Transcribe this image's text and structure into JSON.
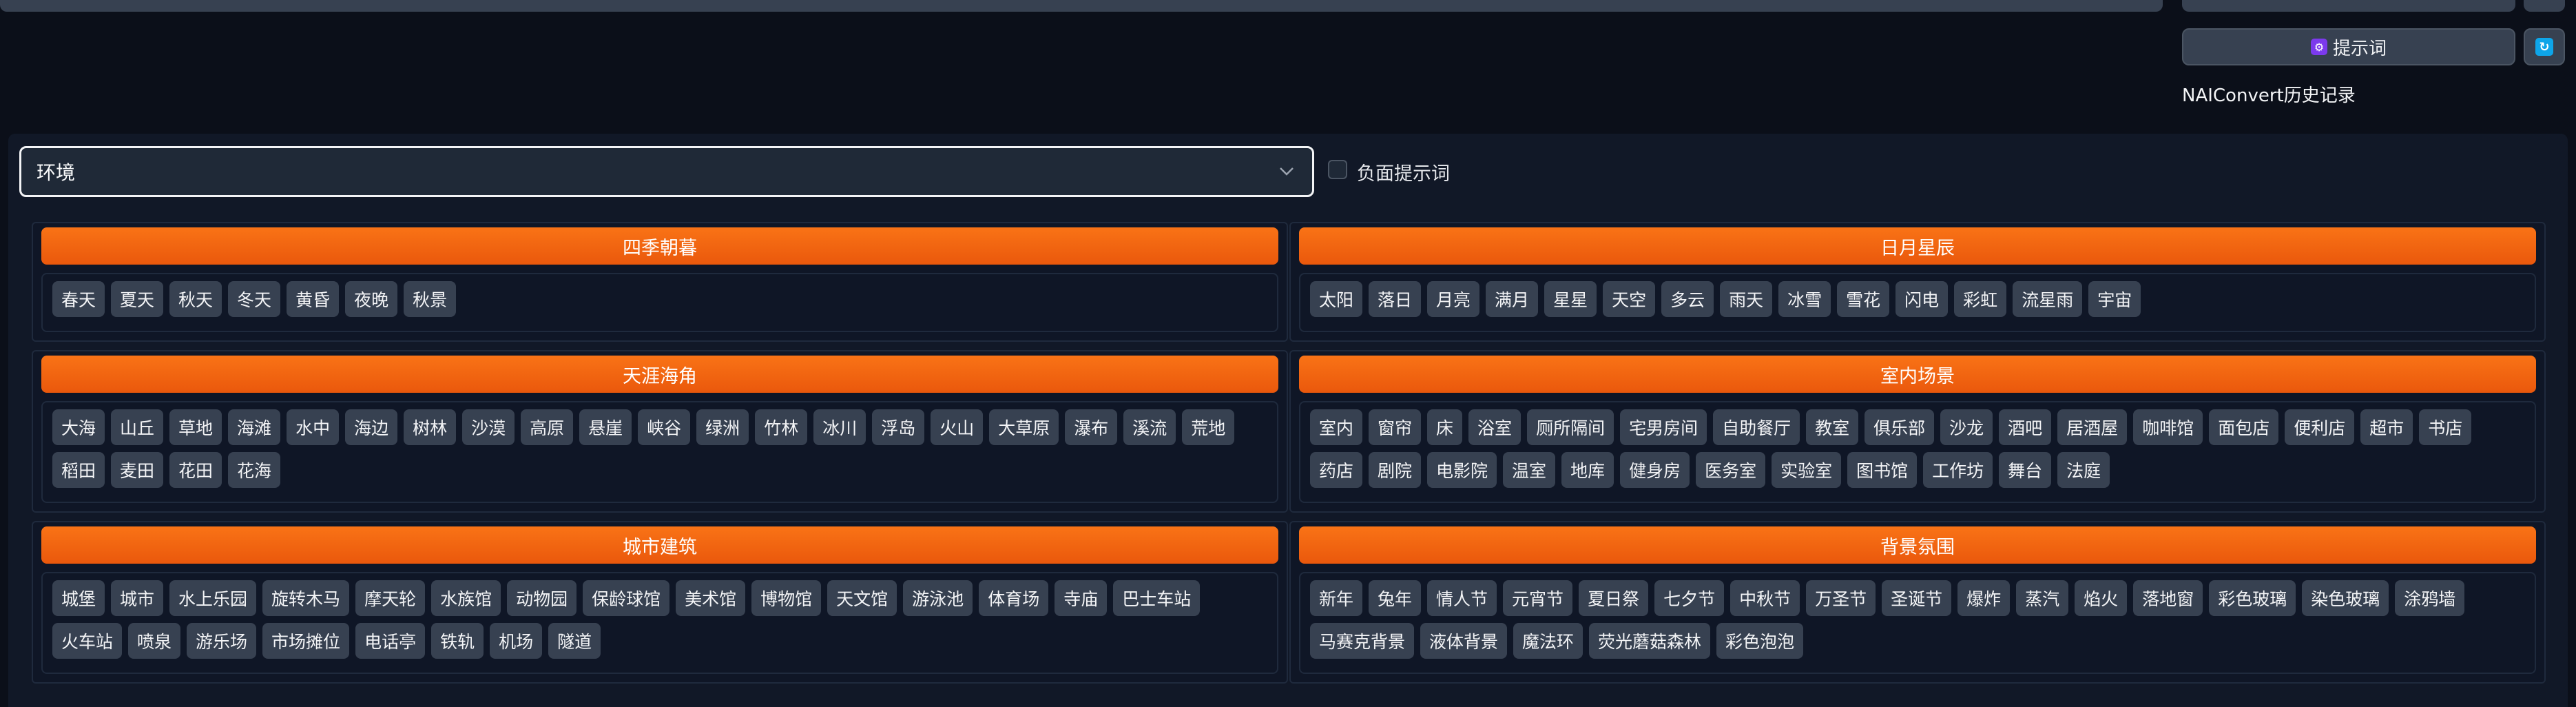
{
  "header": {
    "prompt_button_label": "提示词",
    "prompt_icon": "gear-icon",
    "refresh_icon": "refresh-icon",
    "history_label": "NAIConvert历史记录"
  },
  "controls": {
    "category_select_value": "环境",
    "negative_checkbox_label": "负面提示词",
    "negative_checked": false
  },
  "colors": {
    "accent": "#f97316",
    "panel_bg": "#111827",
    "tag_bg": "#374151"
  },
  "sections": [
    {
      "title": "四季朝暮",
      "tags": [
        "春天",
        "夏天",
        "秋天",
        "冬天",
        "黄昏",
        "夜晚",
        "秋景"
      ]
    },
    {
      "title": "日月星辰",
      "tags": [
        "太阳",
        "落日",
        "月亮",
        "满月",
        "星星",
        "天空",
        "多云",
        "雨天",
        "冰雪",
        "雪花",
        "闪电",
        "彩虹",
        "流星雨",
        "宇宙"
      ]
    },
    {
      "title": "天涯海角",
      "tags": [
        "大海",
        "山丘",
        "草地",
        "海滩",
        "水中",
        "海边",
        "树林",
        "沙漠",
        "高原",
        "悬崖",
        "峡谷",
        "绿洲",
        "竹林",
        "冰川",
        "浮岛",
        "火山",
        "大草原",
        "瀑布",
        "溪流",
        "荒地",
        "稻田",
        "麦田",
        "花田",
        "花海"
      ]
    },
    {
      "title": "室内场景",
      "tags": [
        "室内",
        "窗帘",
        "床",
        "浴室",
        "厕所隔间",
        "宅男房间",
        "自助餐厅",
        "教室",
        "俱乐部",
        "沙龙",
        "酒吧",
        "居酒屋",
        "咖啡馆",
        "面包店",
        "便利店",
        "超市",
        "书店",
        "药店",
        "剧院",
        "电影院",
        "温室",
        "地库",
        "健身房",
        "医务室",
        "实验室",
        "图书馆",
        "工作坊",
        "舞台",
        "法庭"
      ]
    },
    {
      "title": "城市建筑",
      "tags": [
        "城堡",
        "城市",
        "水上乐园",
        "旋转木马",
        "摩天轮",
        "水族馆",
        "动物园",
        "保龄球馆",
        "美术馆",
        "博物馆",
        "天文馆",
        "游泳池",
        "体育场",
        "寺庙",
        "巴士车站",
        "火车站",
        "喷泉",
        "游乐场",
        "市场摊位",
        "电话亭",
        "铁轨",
        "机场",
        "隧道"
      ]
    },
    {
      "title": "背景氛围",
      "tags": [
        "新年",
        "兔年",
        "情人节",
        "元宵节",
        "夏日祭",
        "七夕节",
        "中秋节",
        "万圣节",
        "圣诞节",
        "爆炸",
        "蒸汽",
        "焰火",
        "落地窗",
        "彩色玻璃",
        "染色玻璃",
        "涂鸦墙",
        "马赛克背景",
        "液体背景",
        "魔法环",
        "荧光蘑菇森林",
        "彩色泡泡"
      ]
    }
  ]
}
